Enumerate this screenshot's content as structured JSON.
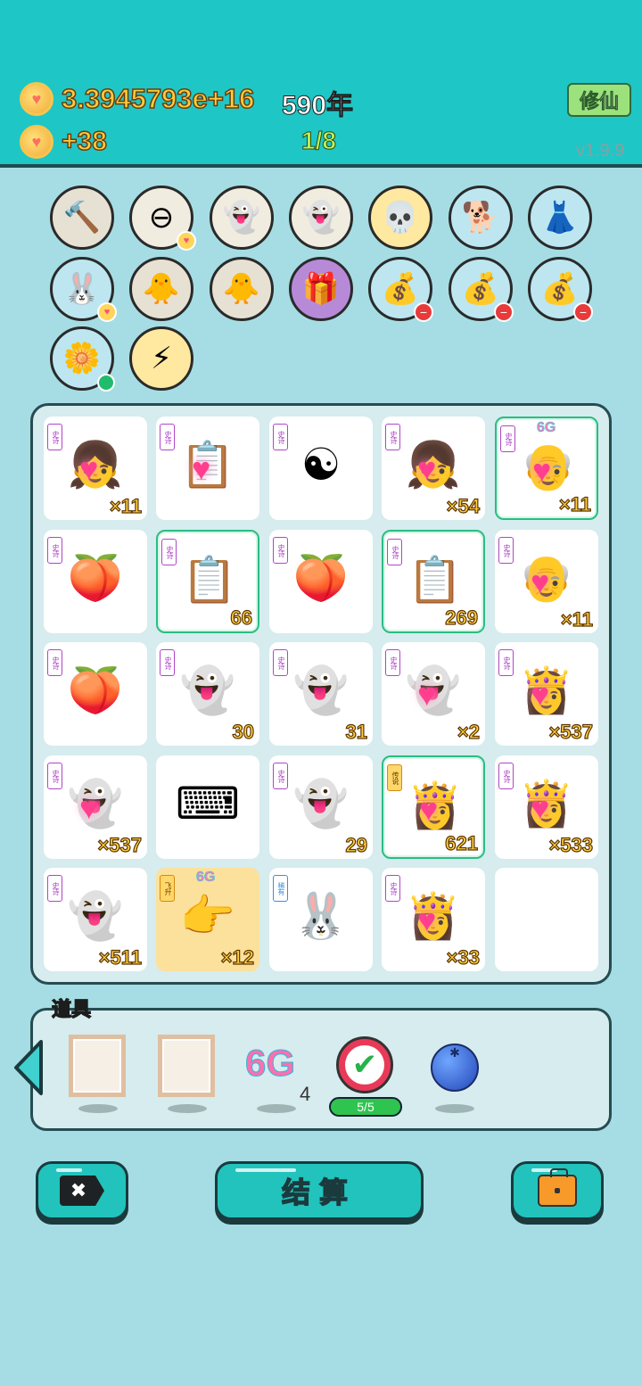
{
  "header": {
    "coins": "3.3945793e+16",
    "years": "590年",
    "income": "+38",
    "level": "1/8",
    "cultivate_label": "修仙",
    "version": "v1.9.9"
  },
  "items": [
    {
      "name": "hammer-icon",
      "glyph": "🔨",
      "style": "c-gray",
      "badge": ""
    },
    {
      "name": "no-entry-icon",
      "glyph": "⊖",
      "style": "c-light",
      "badge": "heart"
    },
    {
      "name": "ghost-wink-icon",
      "glyph": "👻",
      "style": "c-light",
      "badge": ""
    },
    {
      "name": "ghost-tongue-icon",
      "glyph": "👻",
      "style": "c-light",
      "badge": ""
    },
    {
      "name": "gold-skull-icon",
      "glyph": "💀",
      "style": "c-gold",
      "badge": ""
    },
    {
      "name": "cool-dog-icon",
      "glyph": "🐕",
      "style": "c-blue",
      "badge": ""
    },
    {
      "name": "skirt-icon",
      "glyph": "👗",
      "style": "c-blue",
      "badge": ""
    },
    {
      "name": "rabbit-icon",
      "glyph": "🐰",
      "style": "c-blue",
      "badge": "heart"
    },
    {
      "name": "chick-egg-icon",
      "glyph": "🐥",
      "style": "c-gray",
      "badge": ""
    },
    {
      "name": "chick-egg-icon-2",
      "glyph": "🐥",
      "style": "c-gray",
      "badge": ""
    },
    {
      "name": "gift-box-icon",
      "glyph": "🎁",
      "style": "c-purple",
      "badge": ""
    },
    {
      "name": "money-bag-icon",
      "glyph": "💰",
      "style": "c-blue",
      "badge": "minus"
    },
    {
      "name": "money-bag-icon-2",
      "glyph": "💰",
      "style": "c-blue",
      "badge": "minus"
    },
    {
      "name": "money-bag-icon-3",
      "glyph": "💰",
      "style": "c-blue",
      "badge": "minus"
    },
    {
      "name": "potted-flower-icon",
      "glyph": "🌼",
      "style": "c-blue",
      "badge": "dot"
    },
    {
      "name": "lightning-icon",
      "glyph": "⚡",
      "style": "c-gold",
      "badge": ""
    }
  ],
  "board": [
    {
      "tag": "史诗",
      "tag_style": "",
      "glyph": "👧",
      "count": "×11",
      "name": "girl-braids-icon",
      "sel": false,
      "bg": "",
      "grade": "",
      "heart": true
    },
    {
      "tag": "史诗",
      "tag_style": "",
      "glyph": "📋",
      "count": "",
      "name": "copy-paste-icon",
      "sel": false,
      "bg": "",
      "grade": "",
      "heart": true
    },
    {
      "tag": "史诗",
      "tag_style": "",
      "glyph": "☯",
      "count": "",
      "name": "bagua-icon",
      "sel": false,
      "bg": "",
      "grade": "",
      "heart": false
    },
    {
      "tag": "史诗",
      "tag_style": "",
      "glyph": "👧",
      "count": "×54",
      "name": "girl-halo-icon",
      "sel": false,
      "bg": "",
      "grade": "",
      "heart": true
    },
    {
      "tag": "史诗",
      "tag_style": "",
      "glyph": "👴",
      "count": "×11",
      "name": "king-elder-icon",
      "sel": true,
      "bg": "",
      "grade": "6G",
      "heart": true
    },
    {
      "tag": "史诗",
      "tag_style": "",
      "glyph": "🍑",
      "count": "",
      "name": "peach-icon",
      "sel": false,
      "bg": "",
      "grade": "",
      "heart": false
    },
    {
      "tag": "史诗",
      "tag_style": "",
      "glyph": "📋",
      "count": "66",
      "name": "copy-paste-icon-2",
      "sel": true,
      "bg": "",
      "grade": "",
      "heart": false
    },
    {
      "tag": "史诗",
      "tag_style": "",
      "glyph": "🍑",
      "count": "",
      "name": "peach-icon-2",
      "sel": false,
      "bg": "",
      "grade": "",
      "heart": false
    },
    {
      "tag": "史诗",
      "tag_style": "",
      "glyph": "📋",
      "count": "269",
      "name": "copy-paste-icon-3",
      "sel": true,
      "bg": "",
      "grade": "",
      "heart": false
    },
    {
      "tag": "史诗",
      "tag_style": "",
      "glyph": "👴",
      "count": "×11",
      "name": "elder-heart-eyes-icon",
      "sel": false,
      "bg": "",
      "grade": "",
      "heart": true
    },
    {
      "tag": "史诗",
      "tag_style": "",
      "glyph": "🍑",
      "count": "",
      "name": "peach-icon-3",
      "sel": false,
      "bg": "",
      "grade": "",
      "heart": false
    },
    {
      "tag": "史诗",
      "tag_style": "",
      "glyph": "👻",
      "count": "30",
      "name": "ghost-heart-icon",
      "sel": false,
      "bg": "",
      "grade": "",
      "heart": false
    },
    {
      "tag": "史诗",
      "tag_style": "",
      "glyph": "👻",
      "count": "31",
      "name": "ghost-heart-icon-2",
      "sel": false,
      "bg": "",
      "grade": "",
      "heart": false
    },
    {
      "tag": "史诗",
      "tag_style": "",
      "glyph": "👻",
      "count": "×2",
      "name": "ghost-heart-icon-3",
      "sel": false,
      "bg": "",
      "grade": "",
      "heart": true
    },
    {
      "tag": "史诗",
      "tag_style": "",
      "glyph": "👸",
      "count": "×537",
      "name": "princess-icon",
      "sel": false,
      "bg": "",
      "grade": "",
      "heart": true
    },
    {
      "tag": "史诗",
      "tag_style": "",
      "glyph": "👻",
      "count": "×537",
      "name": "ghost-heart-icon-4",
      "sel": false,
      "bg": "",
      "grade": "",
      "heart": true
    },
    {
      "tag": "",
      "tag_style": "",
      "glyph": "⌨",
      "count": "",
      "name": "keyboard-icon",
      "sel": false,
      "bg": "",
      "grade": "",
      "heart": false
    },
    {
      "tag": "史诗",
      "tag_style": "",
      "glyph": "👻",
      "count": "29",
      "name": "ghost-heart-icon-5",
      "sel": false,
      "bg": "",
      "grade": "",
      "heart": false
    },
    {
      "tag": "传说",
      "tag_style": "orange",
      "glyph": "👸",
      "count": "621",
      "name": "legend-princess-icon",
      "sel": true,
      "bg": "",
      "grade": "",
      "heart": true
    },
    {
      "tag": "史诗",
      "tag_style": "",
      "glyph": "👸",
      "count": "×533",
      "name": "princess-icon-2",
      "sel": false,
      "bg": "",
      "grade": "",
      "heart": true
    },
    {
      "tag": "史诗",
      "tag_style": "",
      "glyph": "👻",
      "count": "×511",
      "name": "ghost-heart-icon-6",
      "sel": false,
      "bg": "",
      "grade": "",
      "heart": false
    },
    {
      "tag": "飞升",
      "tag_style": "orange",
      "glyph": "👉",
      "count": "×12",
      "name": "pointing-hand-icon",
      "sel": false,
      "bg": "gold",
      "grade": "6G",
      "heart": false
    },
    {
      "tag": "稀有",
      "tag_style": "blue",
      "glyph": "🐰",
      "count": "",
      "name": "rabbit-book-icon",
      "sel": false,
      "bg": "",
      "grade": "",
      "heart": false
    },
    {
      "tag": "史诗",
      "tag_style": "",
      "glyph": "👸",
      "count": "×33",
      "name": "princess-crown-icon",
      "sel": false,
      "bg": "",
      "grade": "",
      "heart": true
    },
    {
      "tag": "",
      "tag_style": "",
      "glyph": "",
      "count": "",
      "name": "empty-cell",
      "sel": false,
      "bg": "empty",
      "grade": "",
      "heart": false
    }
  ],
  "props": {
    "label": "道具",
    "sixg_label": "6G",
    "sixg_count": "4",
    "check_progress": "5/5"
  },
  "buttons": {
    "settle_label": "结算",
    "close_glyph": "✖"
  },
  "colors": {
    "topbar": "#1fc6c6",
    "background": "#a6dde4",
    "accent_button": "#22c3bd"
  }
}
